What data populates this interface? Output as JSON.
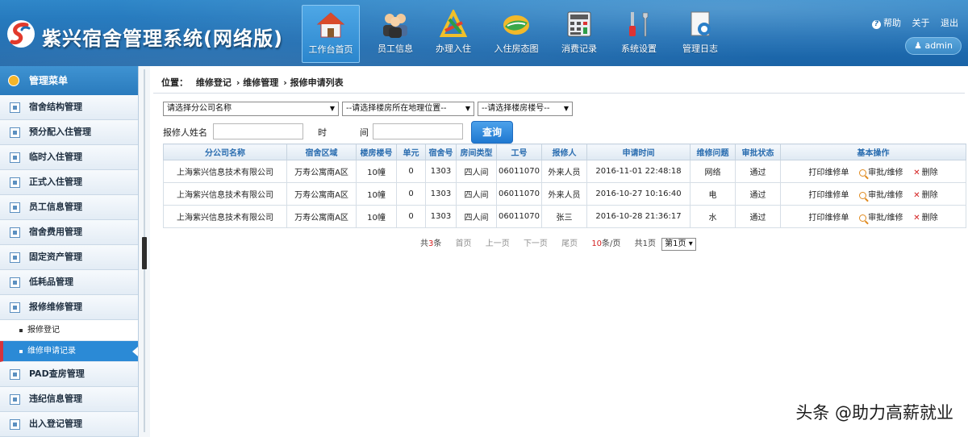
{
  "app": {
    "title": "紫兴宿舍管理系统(网络版)"
  },
  "nav": [
    {
      "label": "工作台首页",
      "icon": "home-icon",
      "active": true
    },
    {
      "label": "员工信息",
      "icon": "staff-icon",
      "active": false
    },
    {
      "label": "办理入住",
      "icon": "checkin-icon",
      "active": false
    },
    {
      "label": "入住房态图",
      "icon": "room-status-icon",
      "active": false
    },
    {
      "label": "消费记录",
      "icon": "calculator-icon",
      "active": false
    },
    {
      "label": "系统设置",
      "icon": "tools-icon",
      "active": false
    },
    {
      "label": "管理日志",
      "icon": "log-icon",
      "active": false
    }
  ],
  "top_links": {
    "help": "帮助",
    "about": "关于",
    "logout": "退出"
  },
  "user": {
    "name": "admin"
  },
  "sidebar": {
    "header": "管理菜单",
    "items_top": [
      "宿舍结构管理",
      "预分配入住管理",
      "临时入住管理",
      "正式入住管理",
      "员工信息管理",
      "宿舍费用管理",
      "固定资产管理",
      "低耗品管理",
      "报修维修管理"
    ],
    "subitems": [
      {
        "label": "报修登记",
        "active": false
      },
      {
        "label": "维修申请记录",
        "active": true
      }
    ],
    "items_bottom": [
      "PAD查房管理",
      "违纪信息管理",
      "出入登记管理"
    ]
  },
  "breadcrumb": {
    "prefix": "位置：",
    "path": [
      "维修登记",
      "维修管理",
      "报修申请列表"
    ]
  },
  "filters": {
    "company": "请选择分公司名称",
    "location": "--请选择楼房所在地理位置--",
    "building": "--请选择楼房楼号--",
    "repairer_label": "报修人姓名",
    "time_label_1": "时",
    "time_label_2": "间",
    "query_button": "查询"
  },
  "table": {
    "columns": [
      "分公司名称",
      "宿舍区域",
      "楼房楼号",
      "单元",
      "宿舍号",
      "房间类型",
      "工号",
      "报修人",
      "申请时间",
      "维修问题",
      "审批状态",
      "基本操作"
    ],
    "rows": [
      {
        "company": "上海紫兴信息技术有限公司",
        "area": "万寿公寓南A区",
        "building": "10幢",
        "unit": "0",
        "room": "1303",
        "type": "四人间",
        "empno": "06011070",
        "person": "外来人员",
        "time": "2016-11-01 22:48:18",
        "issue": "网络",
        "status": "通过"
      },
      {
        "company": "上海紫兴信息技术有限公司",
        "area": "万寿公寓南A区",
        "building": "10幢",
        "unit": "0",
        "room": "1303",
        "type": "四人间",
        "empno": "06011070",
        "person": "外来人员",
        "time": "2016-10-27 10:16:40",
        "issue": "电",
        "status": "通过"
      },
      {
        "company": "上海紫兴信息技术有限公司",
        "area": "万寿公寓南A区",
        "building": "10幢",
        "unit": "0",
        "room": "1303",
        "type": "四人间",
        "empno": "06011070",
        "person": "张三",
        "time": "2016-10-28 21:36:17",
        "issue": "水",
        "status": "通过"
      }
    ],
    "actions": {
      "print": "打印维修单",
      "review": "审批/维修",
      "delete": "删除"
    }
  },
  "pager": {
    "total_prefix": "共",
    "total": "3",
    "total_suffix": "条",
    "first": "首页",
    "prev": "上一页",
    "next": "下一页",
    "last": "尾页",
    "per_page": "10",
    "per_page_suffix": "条/页",
    "pages_text": "共1页",
    "current_page": "第1页"
  },
  "watermark": "头条 @助力高薪就业"
}
